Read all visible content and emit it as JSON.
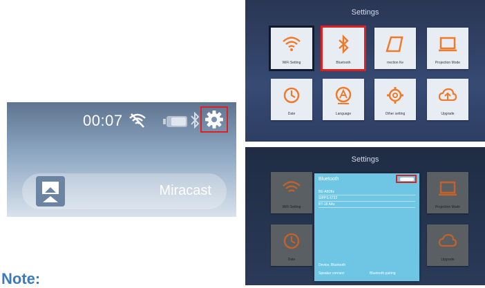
{
  "home": {
    "clock": "00:07",
    "miracast_label": "Miracast"
  },
  "note": {
    "label": "Note:"
  },
  "settings_screen_1": {
    "title": "Settings",
    "tiles": [
      {
        "label": "WiFi Setting",
        "icon": "wifi-icon"
      },
      {
        "label": "Bluetooth",
        "icon": "bluetooth-icon"
      },
      {
        "label": "rrection Ke",
        "icon": "keystone-icon"
      },
      {
        "label": "Projection Mode",
        "icon": "laptop-icon"
      },
      {
        "label": "Date",
        "icon": "clock-icon"
      },
      {
        "label": "Language",
        "icon": "language-icon"
      },
      {
        "label": "Other setting",
        "icon": "gear-icon"
      },
      {
        "label": "Upgrade",
        "icon": "cloud-upgrade-icon"
      }
    ]
  },
  "settings_screen_2": {
    "title": "Settings",
    "tiles": [
      {
        "label": "WiFi Setting"
      },
      {
        "label": "Projection Mode"
      },
      {
        "label": "Date"
      },
      {
        "label": "Upgrade"
      }
    ],
    "dialog": {
      "title": "Bluetooth",
      "devices": [
        "BE-AB2ftz",
        "SIPPS 6722",
        "BT-18 AAx"
      ],
      "footer_status": "Device, Bluetooth",
      "footer_left": "Speaker connect",
      "footer_right": "Bluetooth pairing"
    }
  },
  "colors": {
    "highlight_red": "#e02020",
    "accent_orange": "#f07a2a",
    "note_blue": "#3a7abf",
    "dialog_blue": "#6ec6e4"
  }
}
